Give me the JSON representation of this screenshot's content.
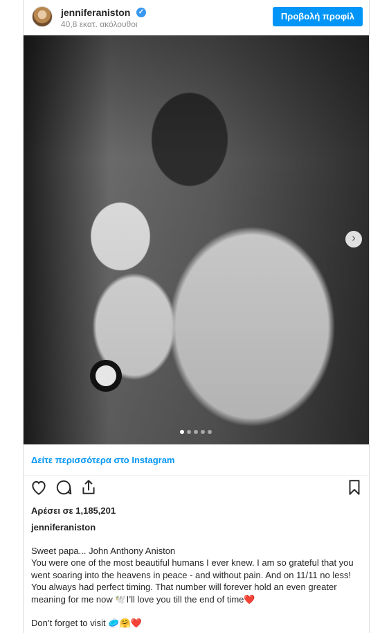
{
  "header": {
    "username": "jenniferaniston",
    "followers": "40,8 εκατ. ακόλουθοι",
    "profile_button": "Προβολή προφίλ"
  },
  "photo": {
    "slide_count": 5,
    "active_slide": 1
  },
  "see_more_link": "Δείτε περισσότερα στο Instagram",
  "likes": "Αρέσει σε 1,185,201",
  "caption": {
    "username": "jenniferaniston",
    "line1": "Sweet papa... John Anthony Aniston",
    "line2": "You were one of the most beautiful humans I ever knew. I am so grateful that you went soaring into the heavens in peace - and without pain. And on 11/11 no less! You always had perfect timing. That number will forever hold an even greater meaning for me now 🕊️I’ll love you till the end of time❤️",
    "line3": "Don’t forget to visit 🥏🤗❤️"
  },
  "colors": {
    "accent": "#0095f6",
    "text": "#262626",
    "muted": "#8e8e8e"
  }
}
